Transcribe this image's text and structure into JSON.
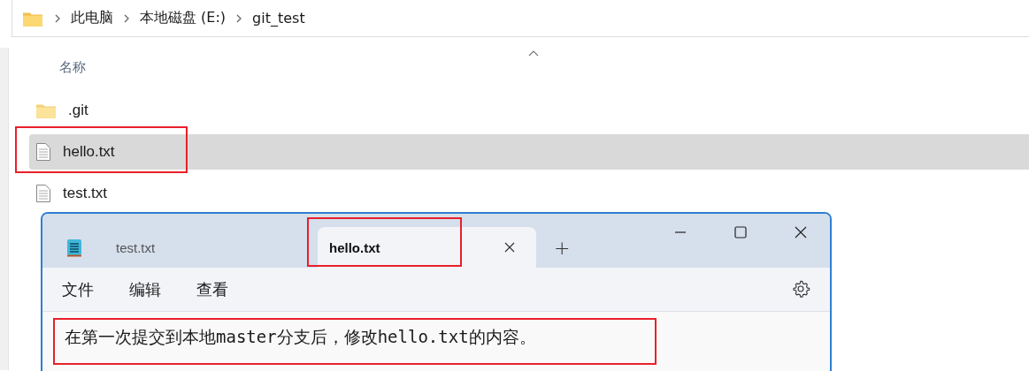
{
  "explorer": {
    "breadcrumb": [
      "此电脑",
      "本地磁盘 (E:)",
      "git_test"
    ],
    "column_header": "名称",
    "files": [
      {
        "name": ".git",
        "kind": "folder",
        "selected": false,
        "highlighted": false
      },
      {
        "name": "hello.txt",
        "kind": "text",
        "selected": true,
        "highlighted": true
      },
      {
        "name": "test.txt",
        "kind": "text",
        "selected": false,
        "highlighted": false
      }
    ]
  },
  "notepad": {
    "tabs": [
      {
        "label": "test.txt",
        "selected": false,
        "highlighted": false
      },
      {
        "label": "hello.txt",
        "selected": true,
        "highlighted": true
      }
    ],
    "new_tab": "+",
    "menu": [
      "文件",
      "编辑",
      "查看"
    ],
    "content": {
      "text": "在第一次提交到本地master分支后，修改hello.txt的内容。",
      "highlighted": true
    }
  }
}
